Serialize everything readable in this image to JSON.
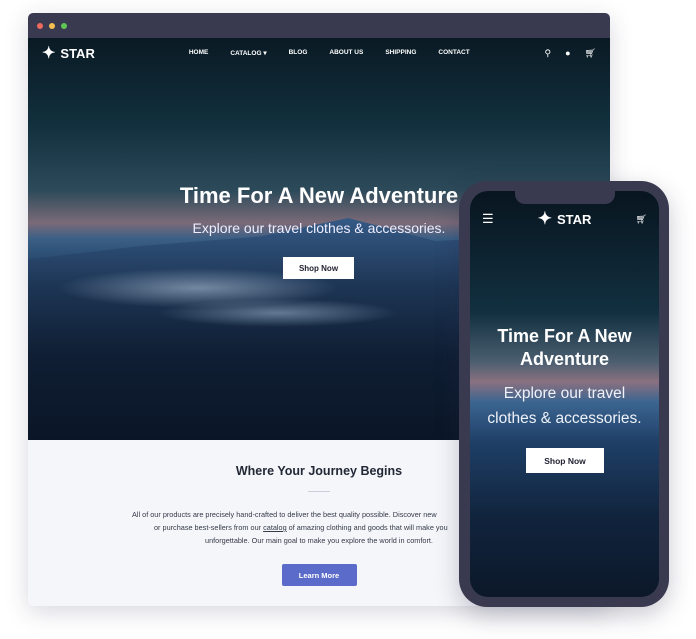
{
  "window": {
    "dots": [
      "#ee6a5f",
      "#f5c04f",
      "#61c554"
    ]
  },
  "brand": {
    "name": "STAR"
  },
  "nav": {
    "items": [
      "HOME",
      "CATALOG",
      "BLOG",
      "ABOUT US",
      "SHIPPING",
      "CONTACT"
    ],
    "icons": [
      "search-icon",
      "user-icon",
      "cart-icon"
    ]
  },
  "hero": {
    "title": "Time For A New Adventure",
    "subtitle": "Explore our travel clothes & accessories.",
    "cta": "Shop Now"
  },
  "section": {
    "title": "Where Your Journey Begins",
    "lines": [
      "All of our products are precisely hand-crafted to deliver the best quality possible. Discover new",
      "or purchase best-sellers from our",
      "catalog",
      "of amazing clothing and goods that will make you",
      "unforgettable. Our main goal to make you explore the world in comfort."
    ],
    "cta": "Learn More",
    "accent": "#5b6bc9"
  },
  "mobile": {
    "title_line1": "Time For A New",
    "title_line2": "Adventure",
    "sub_line1": "Explore our travel",
    "sub_line2": "clothes & accessories.",
    "cta": "Shop Now"
  }
}
